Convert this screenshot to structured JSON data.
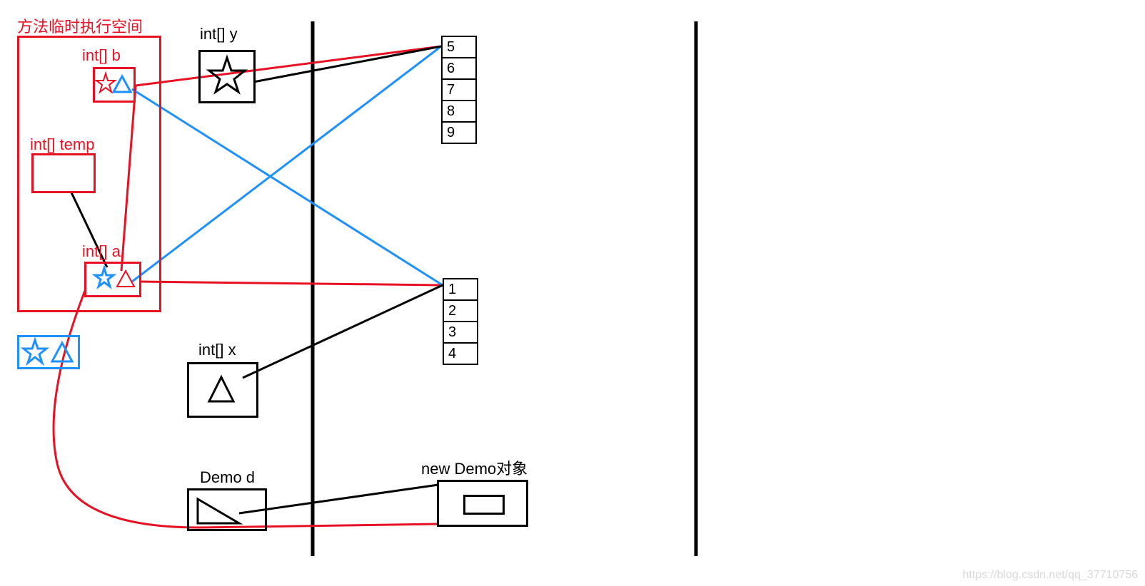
{
  "labels": {
    "methodSpace": "方法临时执行空间",
    "intB": "int[] b",
    "intTemp": "int[] temp",
    "intA": "int[] a",
    "intY": "int[] y",
    "intX": "int[] x",
    "demoD": "Demo d",
    "newDemo": "new Demo对象"
  },
  "array1": [
    "5",
    "6",
    "7",
    "8",
    "9"
  ],
  "array2": [
    "1",
    "2",
    "3",
    "4"
  ],
  "watermark": "https://blog.csdn.net/qq_37710756",
  "colors": {
    "red": "#e81123",
    "blue": "#1e90ff",
    "black": "#000000"
  }
}
